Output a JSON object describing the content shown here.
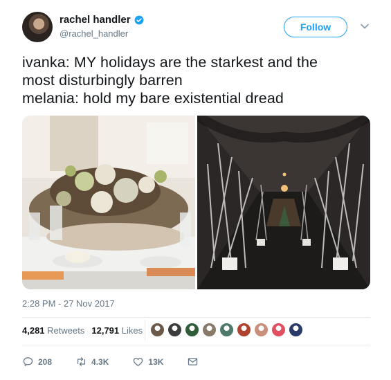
{
  "author": {
    "display_name": "rachel handler",
    "handle": "@rachel_handler",
    "verified": true
  },
  "follow_button": {
    "label": "Follow"
  },
  "tweet": {
    "lines": [
      "ivanka: MY holidays are the starkest and the",
      "most disturbingly barren",
      "melania: hold my bare existential dread"
    ],
    "timestamp": "2:28 PM - 27 Nov 2017"
  },
  "stats": {
    "retweets_count": "4,281",
    "retweets_label": "Retweets",
    "likes_count": "12,791",
    "likes_label": "Likes"
  },
  "likers": [
    {
      "color": "#6b5a4a"
    },
    {
      "color": "#3d3d3d"
    },
    {
      "color": "#2f5d3a"
    },
    {
      "color": "#8a7a6a"
    },
    {
      "color": "#4d7a6a"
    },
    {
      "color": "#b0432f"
    },
    {
      "color": "#c98f7a"
    },
    {
      "color": "#e05060"
    },
    {
      "color": "#2a3a6a"
    }
  ],
  "actions": {
    "reply_count": "208",
    "retweet_count": "4.3K",
    "like_count": "13K"
  },
  "colors": {
    "accent": "#1da1f2",
    "muted": "#657786",
    "text": "#14171a"
  }
}
